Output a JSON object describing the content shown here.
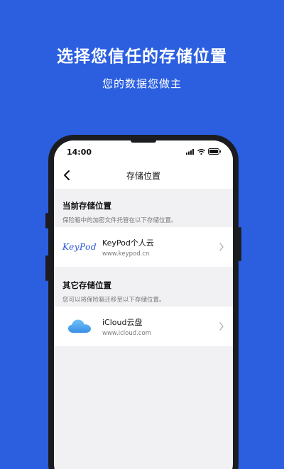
{
  "promo": {
    "headline": "选择您信任的存储位置",
    "subline": "您的数据您做主"
  },
  "status_bar": {
    "time": "14:00"
  },
  "nav": {
    "title": "存储位置"
  },
  "current_section": {
    "title": "当前存储位置",
    "description": "保险箱中的加密文件托管在以下存储位置。",
    "item": {
      "logo_text": "KeyPod",
      "name": "KeyPod个人云",
      "url": "www.keypod.cn"
    }
  },
  "other_section": {
    "title": "其它存储位置",
    "description": "您可以将保险箱迁移至以下存储位置。",
    "item": {
      "name": "iCloud云盘",
      "url": "www.icloud.com"
    }
  },
  "colors": {
    "background": "#2b5fe0",
    "keypod_blue": "#2a56d8",
    "icloud_blue": "#4aa3ee"
  }
}
